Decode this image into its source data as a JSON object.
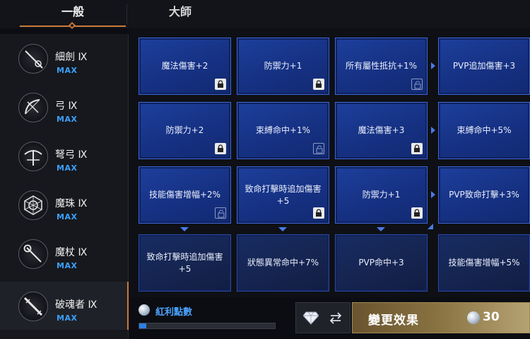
{
  "tabs": [
    {
      "label": "一般",
      "active": true
    },
    {
      "label": "大師",
      "active": false
    }
  ],
  "weapons": [
    {
      "name": "細劍 Ⅸ",
      "level": "MAX",
      "icon": "rapier-icon"
    },
    {
      "name": "弓 Ⅸ",
      "level": "MAX",
      "icon": "bow-icon"
    },
    {
      "name": "弩弓 Ⅸ",
      "level": "MAX",
      "icon": "crossbow-icon"
    },
    {
      "name": "魔珠 Ⅸ",
      "level": "MAX",
      "icon": "orb-icon"
    },
    {
      "name": "魔杖 Ⅸ",
      "level": "MAX",
      "icon": "staff-icon"
    },
    {
      "name": "破魂者 Ⅸ",
      "level": "MAX",
      "icon": "soulbreaker-icon",
      "active": true
    }
  ],
  "grid": [
    [
      {
        "label": "魔法傷害+2",
        "lock": "locked"
      },
      {
        "label": "防禦力+1",
        "lock": "locked"
      },
      {
        "label": "所有屬性抵抗+1%",
        "lock": "unlocked"
      },
      {
        "label": "PVP追加傷害+3",
        "lock": "none"
      }
    ],
    [
      {
        "label": "防禦力+2",
        "lock": "locked"
      },
      {
        "label": "束縛命中+1%",
        "lock": "unlocked"
      },
      {
        "label": "魔法傷害+3",
        "lock": "locked"
      },
      {
        "label": "束縛命中+5%",
        "lock": "none"
      }
    ],
    [
      {
        "label": "技能傷害增幅+2%",
        "lock": "unlocked"
      },
      {
        "label": "致命打擊時追加傷害+5",
        "lock": "locked"
      },
      {
        "label": "防禦力+1",
        "lock": "locked"
      },
      {
        "label": "PVP致命打擊+3%",
        "lock": "none"
      }
    ],
    [
      {
        "label": "致命打擊時追加傷害+5",
        "lock": "none"
      },
      {
        "label": "狀態異常命中+7%",
        "lock": "none"
      },
      {
        "label": "PVP命中+3",
        "lock": "none"
      },
      {
        "label": "技能傷害增幅+5%",
        "lock": "none"
      }
    ]
  ],
  "bonus": {
    "label": "紅利點數",
    "progress": 0.05
  },
  "change": {
    "label": "變更效果",
    "cost": "30"
  },
  "colors": {
    "accent": "#cc7a3a",
    "max": "#3ba0ff",
    "node": "#163183",
    "button": "#87703f"
  }
}
